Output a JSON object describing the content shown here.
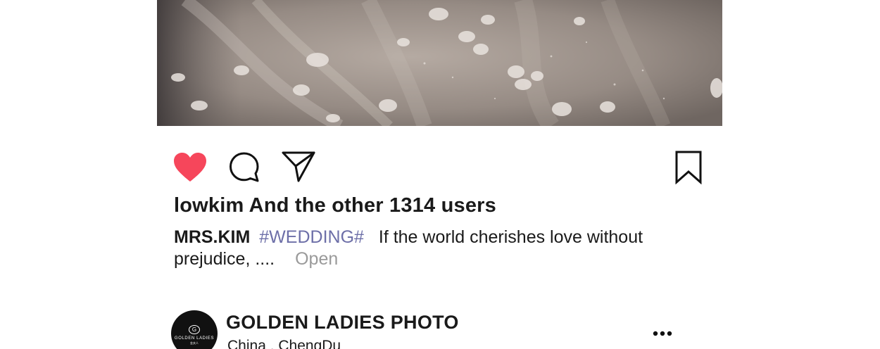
{
  "post": {
    "photo_icon": "wedding-dress-photo",
    "actions": {
      "like_icon": "heart-icon",
      "like_color": "#f6465b",
      "comment_icon": "comment-icon",
      "share_icon": "send-icon",
      "bookmark_icon": "bookmark-icon"
    },
    "likes_text": "lowkim And the other 1314 users",
    "caption": {
      "author": "MRS.KIM",
      "hashtag": "#WEDDING#",
      "text": "If the world cherishes love without prejudice, ....",
      "more_label": "Open",
      "hashtag_color": "#6d6fa8"
    }
  },
  "next_post": {
    "avatar": {
      "icon": "golden-ladies-logo",
      "logo_text": "GOLDEN LADIES",
      "logo_subtext": "金夫人"
    },
    "account_name": "GOLDEN LADIES PHOTO",
    "location": "China , ChengDu",
    "more_icon": "more-options-icon"
  }
}
